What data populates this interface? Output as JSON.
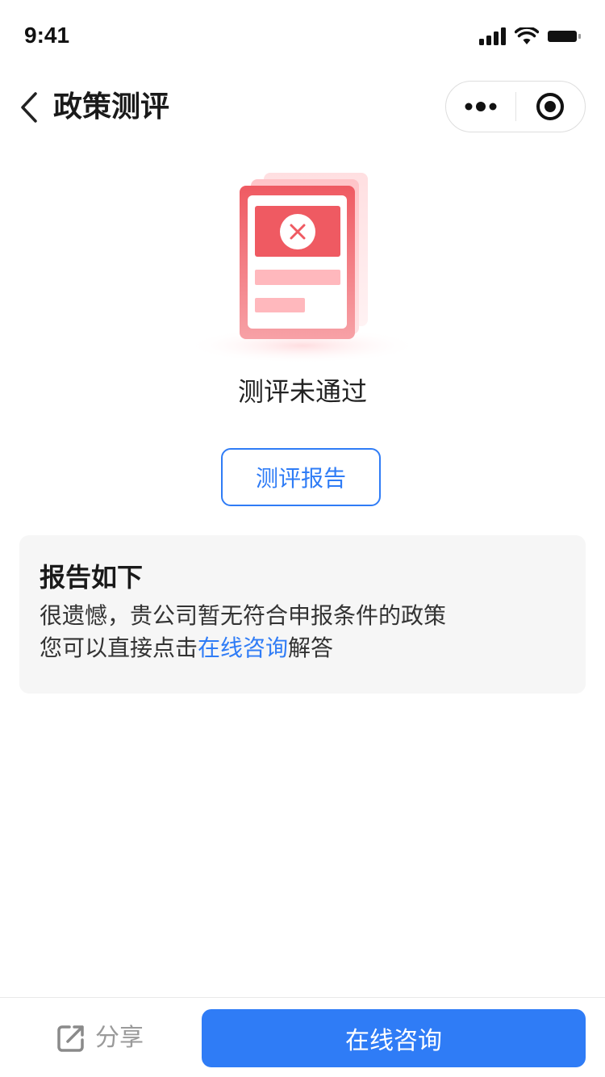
{
  "status_bar": {
    "time": "9:41"
  },
  "nav": {
    "title": "政策测评"
  },
  "result": {
    "title": "测评未通过"
  },
  "report_button": {
    "label": "测评报告"
  },
  "report": {
    "heading": "报告如下",
    "line1": "很遗憾，贵公司暂无符合申报条件的政策",
    "line2_prefix": "您可以直接点击",
    "line2_link": "在线咨询",
    "line2_suffix": "解答"
  },
  "bottom": {
    "share_label": "分享",
    "consult_label": "在线咨询"
  },
  "colors": {
    "accent": "#2f7cf6",
    "error": "#ef5a62",
    "error_light": "#ffb8bd",
    "card_bg": "#f6f6f6"
  },
  "icons": [
    "back-chevron-icon",
    "more-icon",
    "close-circle-icon",
    "share-icon",
    "error-x-icon",
    "signal-icon",
    "wifi-icon",
    "battery-icon"
  ]
}
